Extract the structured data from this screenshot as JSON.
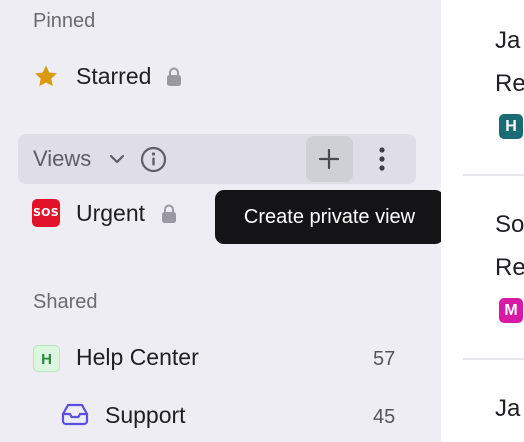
{
  "sidebar": {
    "pinned_label": "Pinned",
    "starred_label": "Starred",
    "views_label": "Views",
    "urgent_label": "Urgent",
    "sos_text": "SOS",
    "shared_label": "Shared",
    "help_center_label": "Help Center",
    "help_center_avatar": "H",
    "help_center_count": "57",
    "support_label": "Support",
    "support_count": "45"
  },
  "tooltip": {
    "text": "Create private view"
  },
  "conversations": [
    {
      "title": "Ja",
      "subtitle": "Re",
      "badge": "H",
      "badge_color": "#1b6b74"
    },
    {
      "title": "So",
      "subtitle": "Re",
      "badge": "M",
      "badge_color": "#d61aa6"
    },
    {
      "title": "Ja"
    }
  ],
  "colors": {
    "sidebar_bg": "#eeedf3",
    "star": "#d99a0e",
    "sos": "#e3122b",
    "accent": "#5b4fe0"
  }
}
